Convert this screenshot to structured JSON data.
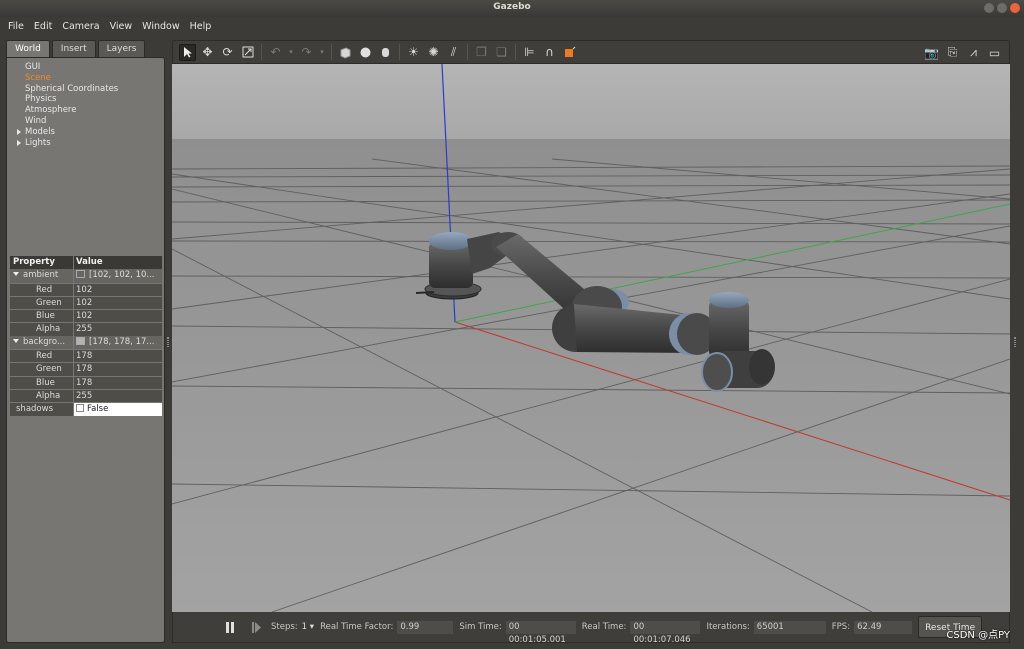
{
  "window": {
    "title": "Gazebo"
  },
  "menu": [
    "File",
    "Edit",
    "Camera",
    "View",
    "Window",
    "Help"
  ],
  "left_panel": {
    "tabs": [
      "World",
      "Insert",
      "Layers"
    ],
    "tree": [
      {
        "label": "GUI",
        "expandable": false,
        "selected": false
      },
      {
        "label": "Scene",
        "expandable": false,
        "selected": true
      },
      {
        "label": "Spherical Coordinates",
        "expandable": false,
        "selected": false
      },
      {
        "label": "Physics",
        "expandable": false,
        "selected": false
      },
      {
        "label": "Atmosphere",
        "expandable": false,
        "selected": false
      },
      {
        "label": "Wind",
        "expandable": false,
        "selected": false
      },
      {
        "label": "Models",
        "expandable": true,
        "selected": false
      },
      {
        "label": "Lights",
        "expandable": true,
        "selected": false
      }
    ],
    "properties": {
      "header_property": "Property",
      "header_value": "Value",
      "ambient": {
        "label": "ambient",
        "summary": "[102, 102, 10...",
        "swatch_color": "#666666",
        "rows": [
          {
            "name": "Red",
            "value": "102"
          },
          {
            "name": "Green",
            "value": "102"
          },
          {
            "name": "Blue",
            "value": "102"
          },
          {
            "name": "Alpha",
            "value": "255"
          }
        ]
      },
      "background": {
        "label": "backgro...",
        "summary": "[178, 178, 17...",
        "swatch_color": "#b2b2b2",
        "rows": [
          {
            "name": "Red",
            "value": "178"
          },
          {
            "name": "Green",
            "value": "178"
          },
          {
            "name": "Blue",
            "value": "178"
          },
          {
            "name": "Alpha",
            "value": "255"
          }
        ]
      },
      "shadows": {
        "label": "shadows",
        "value": "False"
      }
    }
  },
  "status": {
    "steps_label": "Steps:",
    "steps_value": "1",
    "rtf_label": "Real Time Factor:",
    "rtf_value": "0.99",
    "sim_label": "Sim Time:",
    "sim_value": "00 00:01:05.001",
    "real_label": "Real Time:",
    "real_value": "00 00:01:07.046",
    "iter_label": "Iterations:",
    "iter_value": "65001",
    "fps_label": "FPS:",
    "fps_value": "62.49",
    "reset_label": "Reset Time"
  },
  "watermark": "CSDN @点PY",
  "colors": {
    "selected_tree": "#f08a24",
    "x_axis": "#c0392b",
    "y_axis": "#3da64a",
    "z_axis": "#2a3ccf",
    "sky": "#b3b3b3",
    "ground": "#999999",
    "robot_body": "#4a4a4a",
    "robot_cap": "#7a8fa6"
  }
}
